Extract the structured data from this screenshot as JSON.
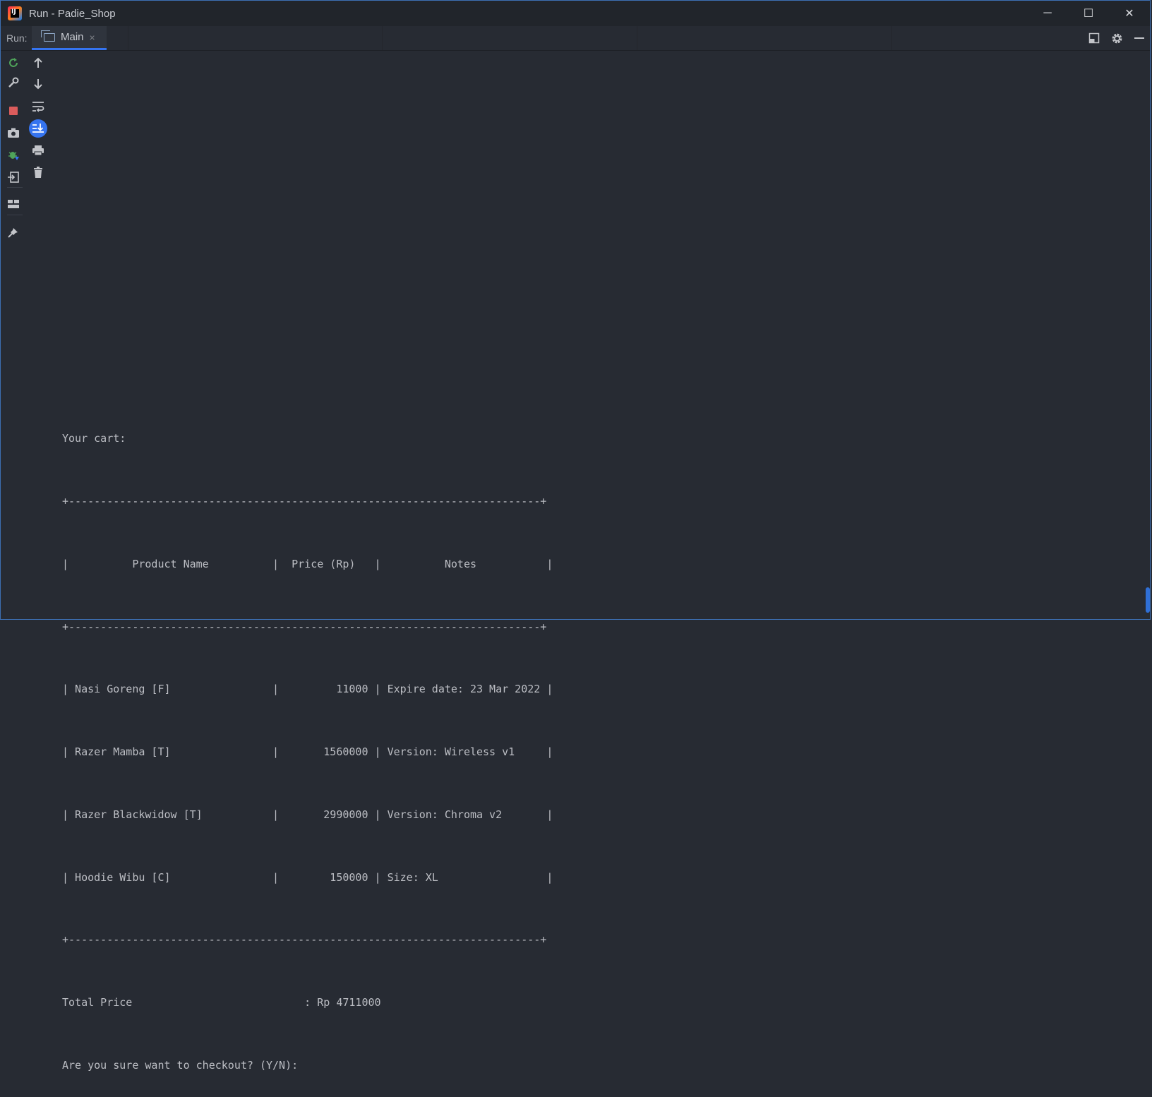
{
  "window": {
    "title": "Run - Padie_Shop",
    "controls": {
      "minimize": "─",
      "maximize": "☐",
      "close": "✕"
    }
  },
  "run_panel": {
    "label": "Run:",
    "tabs": [
      {
        "label": "Main",
        "close": "×",
        "icon": "console-tab-icon"
      }
    ],
    "right_tools": [
      "layout-icon",
      "gear-icon",
      "hide-icon"
    ]
  },
  "left_toolbar_primary": [
    "rerun-icon",
    "edit-config-icon",
    "stop-icon",
    "camera-icon",
    "debug-rerun-icon",
    "export-icon",
    "layout-grid-icon",
    "pin-icon"
  ],
  "left_toolbar_secondary": [
    "up-arrow-icon",
    "down-arrow-icon",
    "soft-wrap-icon",
    "scroll-to-end-icon",
    "print-icon",
    "trash-icon"
  ],
  "console": {
    "lines": [
      "Your cart:",
      "+--------------------------------------------------------------------------+",
      "|          Product Name          |  Price (Rp)   |          Notes           |",
      "+--------------------------------------------------------------------------+",
      "| Nasi Goreng [F]                |         11000 | Expire date: 23 Mar 2022 |",
      "| Razer Mamba [T]                |       1560000 | Version: Wireless v1     |",
      "| Razer Blackwidow [T]           |       2990000 | Version: Chroma v2       |",
      "| Hoodie Wibu [C]                |        150000 | Size: XL                 |",
      "+--------------------------------------------------------------------------+",
      "Total Price                           : Rp 4711000",
      "Are you sure want to checkout? (Y/N): "
    ]
  },
  "colors": {
    "background": "#272b33",
    "titlebar": "#21252b",
    "accent": "#3574f0",
    "text": "#bcbec4"
  }
}
